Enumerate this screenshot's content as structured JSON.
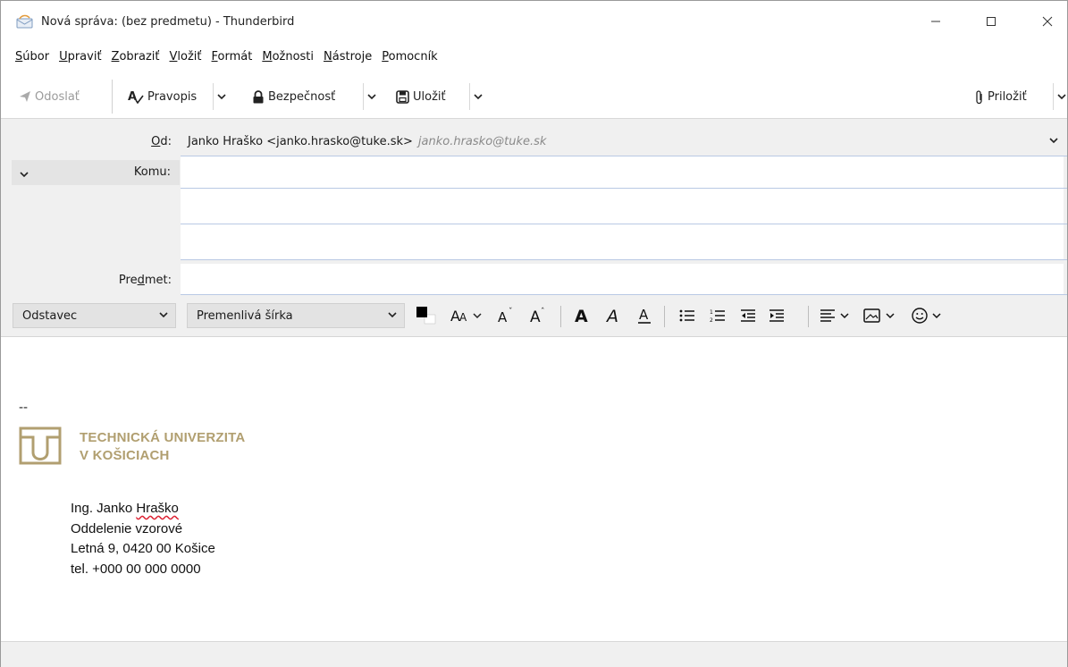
{
  "window": {
    "title": "Nová správa: (bez predmetu) - Thunderbird"
  },
  "menu": {
    "items": [
      {
        "accel": "S",
        "rest": "úbor"
      },
      {
        "accel": "U",
        "rest": "praviť"
      },
      {
        "accel": "Z",
        "rest": "obraziť"
      },
      {
        "accel": "V",
        "rest": "ložiť"
      },
      {
        "accel": "F",
        "rest": "ormát"
      },
      {
        "accel": "M",
        "rest": "ožnosti"
      },
      {
        "accel": "N",
        "rest": "ástroje"
      },
      {
        "accel": "P",
        "rest": "omocník"
      }
    ]
  },
  "toolbar": {
    "send_label": "Odoslať",
    "spelling_label": "Pravopis",
    "security_label": "Bezpečnosť",
    "save_label": "Uložiť",
    "attach_label": "Priložiť"
  },
  "headers": {
    "from_label": "Od:",
    "from_value": "Janko Hraško <janko.hrasko@tuke.sk>",
    "from_hint": "janko.hrasko@tuke.sk",
    "to_label": "Komu:",
    "subject_label": "Predmet:"
  },
  "format": {
    "paragraph_select": "Odstavec",
    "font_select": "Premenlivá šírka"
  },
  "signature": {
    "dash": "--",
    "logo_line1": "TECHNICKÁ UNIVERZITA",
    "logo_line2": "V KOŠICIACH",
    "name_prefix": "Ing. Janko ",
    "name_surname": "Hraško",
    "department": "Oddelenie vzorové",
    "address": "Letná 9, 0420 00 Košice",
    "phone": "tel. +000 00 000 0000"
  },
  "colors": {
    "accent_line": "#b9c9e4",
    "logo_gold": "#b19f70",
    "header_bg": "#f0f0f0"
  }
}
